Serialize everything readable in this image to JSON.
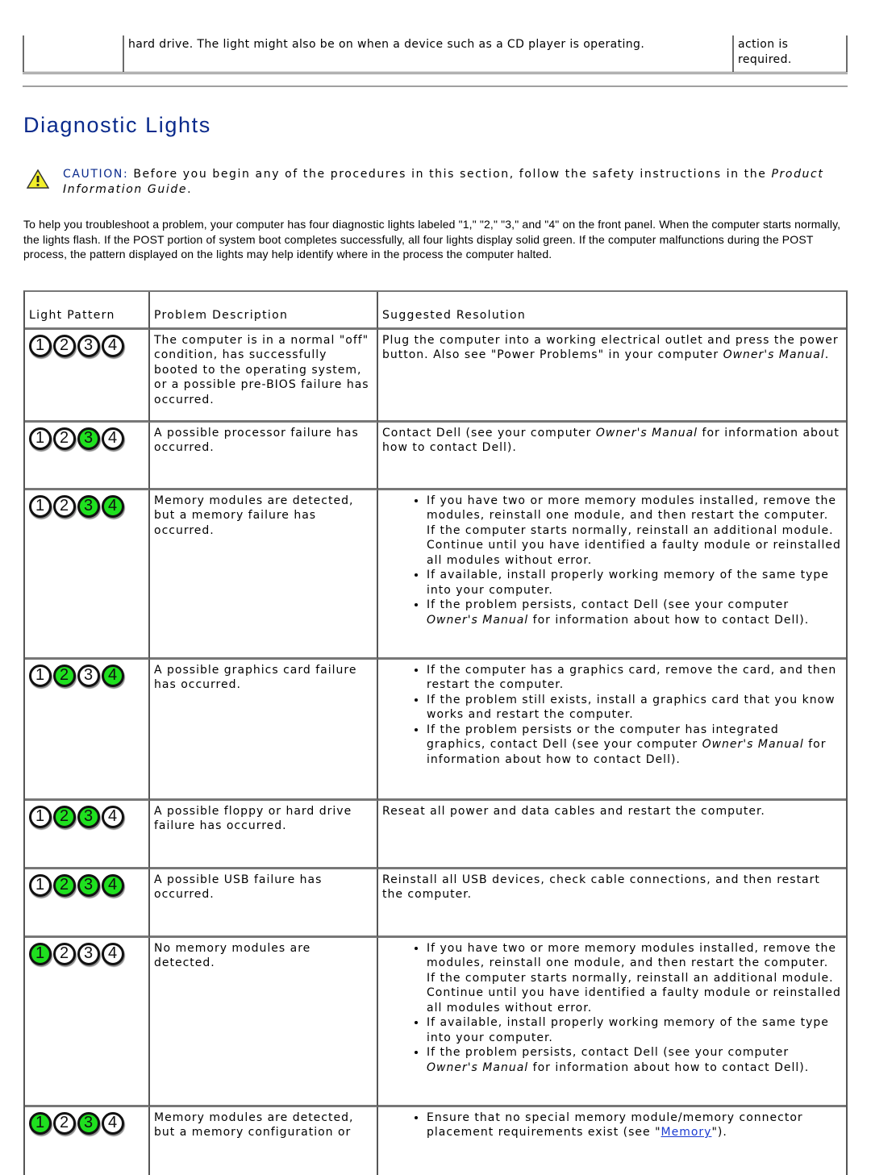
{
  "top_fragment": {
    "cells": [
      "",
      "hard drive. The light might also be on when a device such as a CD player is operating.",
      "action is required."
    ]
  },
  "page_title": "Diagnostic Lights",
  "caution": {
    "icon": "warning-triangle-icon",
    "label": "CAUTION:",
    "text": " Before you begin any of the procedures in this section, follow the safety instructions in the ",
    "guide": "Product Information Guide",
    "end": "."
  },
  "intro": "To help you troubleshoot a problem, your computer has four diagnostic lights labeled \"1,\" \"2,\" \"3,\" and \"4\" on the front panel. When the computer starts normally, the lights flash. If the POST portion of system boot completes successfully, all four lights display solid green. If the computer malfunctions during the POST process, the pattern displayed on the lights may help identify where in the process the computer halted.",
  "colors": {
    "light_on": "#1fe01f",
    "light_off": "#ffffff",
    "title": "#0a2a8c",
    "link": "#1a3bd1"
  },
  "table": {
    "headers": [
      "Light Pattern",
      "Problem Description",
      "Suggested Resolution"
    ],
    "rows": [
      {
        "lights": [
          false,
          false,
          false,
          false
        ],
        "problem": "The computer is in a normal \"off\" condition, has successfully booted to the operating system, or a possible pre-BIOS failure has occurred.",
        "resolution_text": "Plug the computer into a working electrical outlet and press the power button. Also see \"Power Problems\" in your computer ",
        "resolution_italic": "Owner's Manual",
        "resolution_end": "."
      },
      {
        "lights": [
          false,
          false,
          true,
          false
        ],
        "problem": "A possible processor failure has occurred.",
        "resolution_text": "Contact Dell (see your computer ",
        "resolution_italic": "Owner's Manual",
        "resolution_end": " for information about how to contact Dell)."
      },
      {
        "lights": [
          false,
          false,
          true,
          true
        ],
        "problem": "Memory modules are detected, but a memory failure has occurred.",
        "bullets": [
          "If you have two or more memory modules installed, remove the modules, reinstall one module, and then restart the computer. If the computer starts normally, reinstall an additional module. Continue until you have identified a faulty module or reinstalled all modules without error.",
          "If available, install properly working memory of the same type into your computer.",
          "If the problem persists, contact Dell (see your computer |Owner's Manual| for information about how to contact Dell)."
        ]
      },
      {
        "lights": [
          false,
          true,
          false,
          true
        ],
        "problem": "A possible graphics card failure has occurred.",
        "bullets": [
          "If the computer has a graphics card, remove the card, and then restart the computer.",
          "If the problem still exists, install a graphics card that you know works and restart the computer.",
          "If the problem persists or the computer has integrated graphics, contact Dell (see your computer |Owner's Manual| for information about how to contact Dell)."
        ]
      },
      {
        "lights": [
          false,
          true,
          true,
          false
        ],
        "problem": "A possible floppy or hard drive failure has occurred.",
        "resolution_text": "Reseat all power and data cables and restart the computer."
      },
      {
        "lights": [
          false,
          true,
          true,
          true
        ],
        "problem": "A possible USB failure has occurred.",
        "resolution_text": "Reinstall all USB devices, check cable connections, and then restart the computer."
      },
      {
        "lights": [
          true,
          false,
          false,
          false
        ],
        "problem": "No memory modules are detected.",
        "bullets": [
          "If you have two or more memory modules installed, remove the modules, reinstall one module, and then restart the computer. If the computer starts normally, reinstall an additional module. Continue until you have identified a faulty module or reinstalled all modules without error.",
          "If available, install properly working memory of the same type into your computer.",
          "If the problem persists, contact Dell (see your computer |Owner's Manual| for information about how to contact Dell)."
        ]
      },
      {
        "lights": [
          true,
          false,
          true,
          false
        ],
        "problem": "Memory modules are detected, but a memory configuration or",
        "bullets": [
          "Ensure that no special memory module/memory connector placement requirements exist (see \"{Memory}\")."
        ]
      }
    ]
  }
}
